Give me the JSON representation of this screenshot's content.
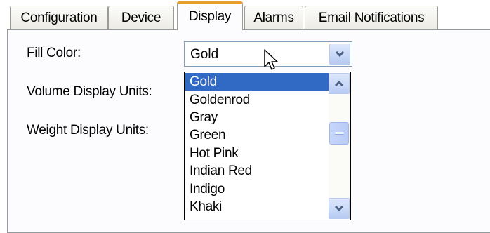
{
  "tabs": [
    {
      "label": "Configuration",
      "active": false
    },
    {
      "label": "Device",
      "active": false
    },
    {
      "label": "Display",
      "active": true
    },
    {
      "label": "Alarms",
      "active": false
    },
    {
      "label": "Email Notifications",
      "active": false
    }
  ],
  "form": {
    "fill_color_label": "Fill Color:",
    "volume_units_label": "Volume Display Units:",
    "weight_units_label": "Weight Display Units:",
    "fill_color_value": "Gold"
  },
  "dropdown": {
    "options": [
      "Gold",
      "Goldenrod",
      "Gray",
      "Green",
      "Hot Pink",
      "Indian Red",
      "Indigo",
      "Khaki"
    ],
    "selected": "Gold",
    "highlight_color": "#316ac5"
  },
  "icons": {
    "combo_arrow": "chevron-down-icon",
    "scroll_up": "chevron-up-icon",
    "scroll_down": "chevron-down-icon",
    "cursor": "mouse-pointer-icon"
  }
}
